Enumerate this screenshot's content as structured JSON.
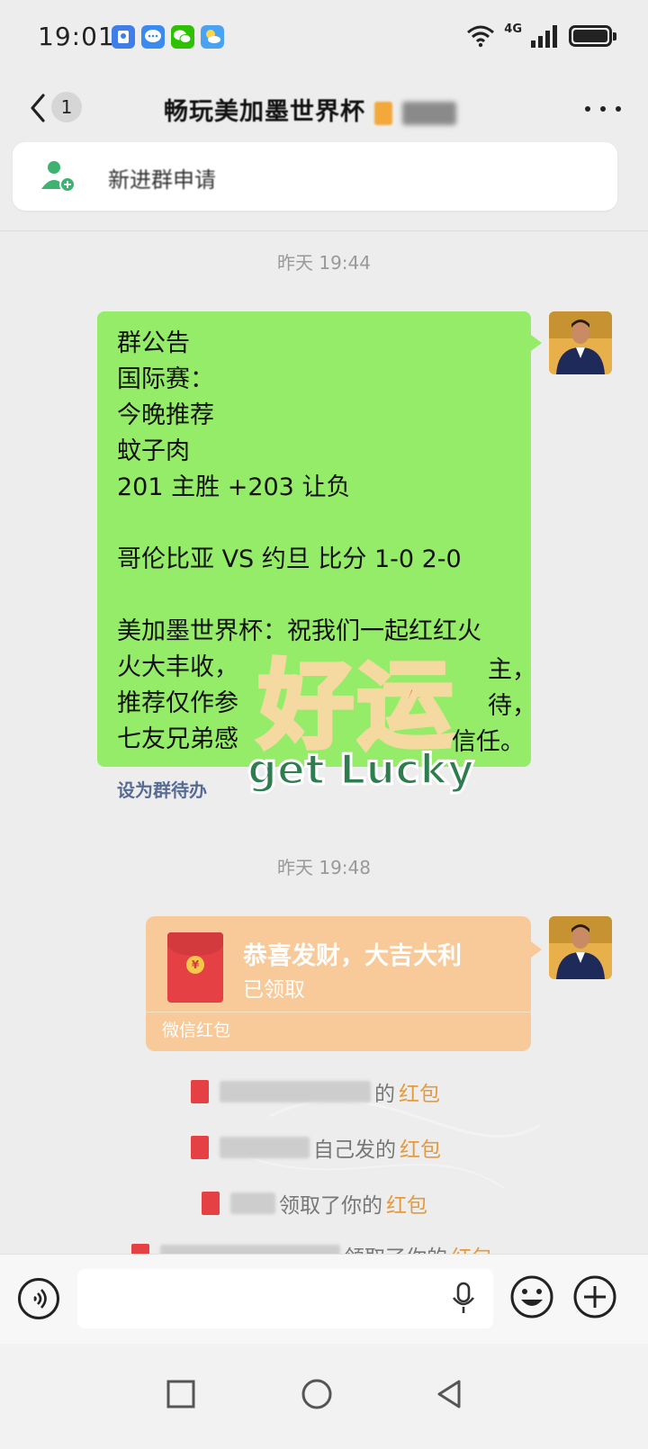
{
  "status_bar": {
    "time": "19:01",
    "network": "4G",
    "icons": [
      "location-app-icon",
      "message-app-icon",
      "wechat-icon",
      "weather-icon",
      "wifi-icon",
      "signal-icon",
      "battery-icon"
    ]
  },
  "header": {
    "back_icon": "chevron-left-icon",
    "unread_count": "1",
    "title_visible": "畅玩美加墨世界杯",
    "more_icon": "more-dots-icon"
  },
  "join_banner": {
    "icon": "add-user-icon",
    "text": "新进群申请"
  },
  "messages": {
    "timestamp_1": "昨天 19:44",
    "announcement_lines": [
      "群公告",
      "国际赛：",
      "今晚推荐",
      "蚊子肉",
      "201 主胜 +203 让负",
      "",
      "哥伦比亚 VS 约旦 比分 1-0  2-0",
      "",
      "美加墨世界杯：祝我们一起红红火",
      "火大丰收，",
      "推荐仅作参",
      "七友兄弟感"
    ],
    "announcement_partial": [
      "主，",
      "待，",
      "信任。"
    ],
    "todo_link": "设为群待办",
    "sticker_text_top": "好运",
    "sticker_text_bottom": "get Lucky",
    "timestamp_2": "昨天 19:48",
    "red_packet": {
      "title": "恭喜发财，大吉大利",
      "status": "已领取",
      "footer": "微信红包",
      "coin_symbol": "¥"
    },
    "notices": [
      {
        "tail": "的",
        "link": "红包"
      },
      {
        "tail": "自己发的",
        "link": "红包"
      },
      {
        "tail": "领取了你的",
        "link": "红包"
      },
      {
        "tail": "领取了你的",
        "link": "红包"
      }
    ]
  },
  "input_bar": {
    "voice_icon": "voice-icon",
    "mic_icon": "mic-icon",
    "emoji_icon": "emoji-icon",
    "plus_icon": "plus-icon",
    "placeholder": ""
  },
  "nav_bar": {
    "icons": [
      "recent-apps-icon",
      "home-icon",
      "back-icon"
    ]
  },
  "colors": {
    "background": "#ededed",
    "bubble_green": "#95ec69",
    "red_packet": "#f8c999",
    "link_blue": "#576b95",
    "sticker_red": "#e8502e",
    "sticker_green": "#2e7d4e"
  }
}
